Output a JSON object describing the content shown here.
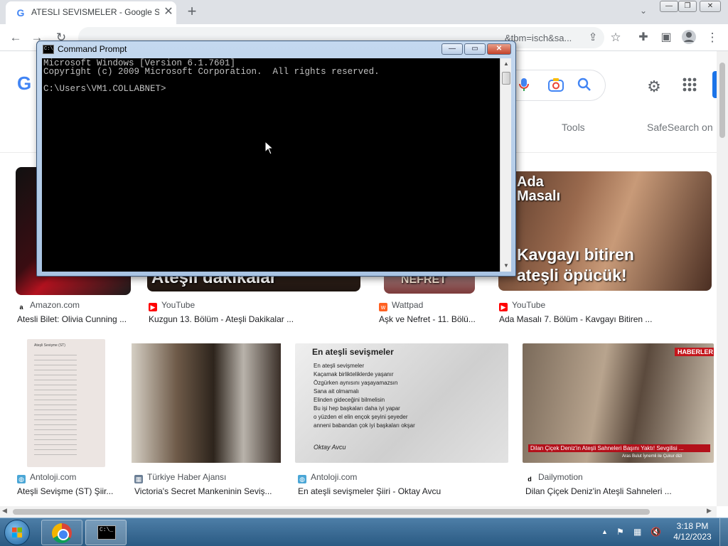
{
  "browser": {
    "tab_title": "ATESLI SEVISMELER - Google Se",
    "url_tail": "&tbm=isch&sa...",
    "colors": {
      "tabbar_bg": "#dee1e6",
      "accent": "#1a73e8"
    }
  },
  "google": {
    "logo_letter": "G",
    "tools": "Tools",
    "safesearch": "SafeSearch on"
  },
  "results": [
    {
      "source": "Amazon.com",
      "title": "Atesli Bilet: Olivia Cunning ...",
      "image_text": ""
    },
    {
      "source": "YouTube",
      "title": "Kuzgun 13. Bölüm - Ateşli Dakikalar ...",
      "image_text": "Ateşli dakikalar"
    },
    {
      "source": "Wattpad",
      "title": "Aşk ve Nefret - 11. Bölü...",
      "image_text": "NEFRET"
    },
    {
      "source": "YouTube",
      "title": "Ada Masalı 7. Bölüm - Kavgayı Bitiren ...",
      "image_text_1": "Ada",
      "image_text_2": "Masalı",
      "image_text_3": "Kavgayı bitiren",
      "image_text_4": "ateşli öpücük!"
    },
    {
      "source": "Antoloji.com",
      "title": "Ateşli Sevişme (ST) Şiir...",
      "image_text": "Ateşli Sevişme (ST)"
    },
    {
      "source": "Türkiye Haber Ajansı",
      "title": "Victoria's Secret Mankeninin Seviş..."
    },
    {
      "source": "Antoloji.com",
      "title": "En ateşli sevişmeler Şiiri - Oktay Avcu"
    },
    {
      "source": "Dailymotion",
      "title": "Dilan Çiçek Deniz'in Ateşli Sahneleri ...",
      "badge": "HABERLER",
      "caption": "Dilan Çiçek Deniz'in Ateşli Sahneleri Başını Yaktı! Sevgilisi ...",
      "caption2": "Aras Bulut İynemli ile Çukur dizi"
    }
  ],
  "poem": {
    "title": "En ateşli sevişmeler",
    "lines": [
      "En ateşli sevişmeler",
      "Kaçamak birlikteliklerde yaşanır",
      "Özgürken aynısını yaşayamazsın",
      "Sana ait olmamalı",
      "Elinden gideceğini bilmelisin",
      "Bu işi hep başkaları daha iyi yapar",
      "o yüzden el elin ençok şeyini şeyeder",
      "anneni babandan çok iyi başkaları okşar"
    ],
    "author": "Oktay Avcu"
  },
  "cmd": {
    "title": "Command Prompt",
    "lines": [
      "Microsoft Windows [Version 6.1.7601]",
      "Copyright (c) 2009 Microsoft Corporation.  All rights reserved.",
      "",
      "C:\\Users\\VM1.COLLABNET>"
    ],
    "icon_text": "C:\\_"
  },
  "taskbar": {
    "time": "3:18 PM",
    "date": "4/12/2023"
  }
}
